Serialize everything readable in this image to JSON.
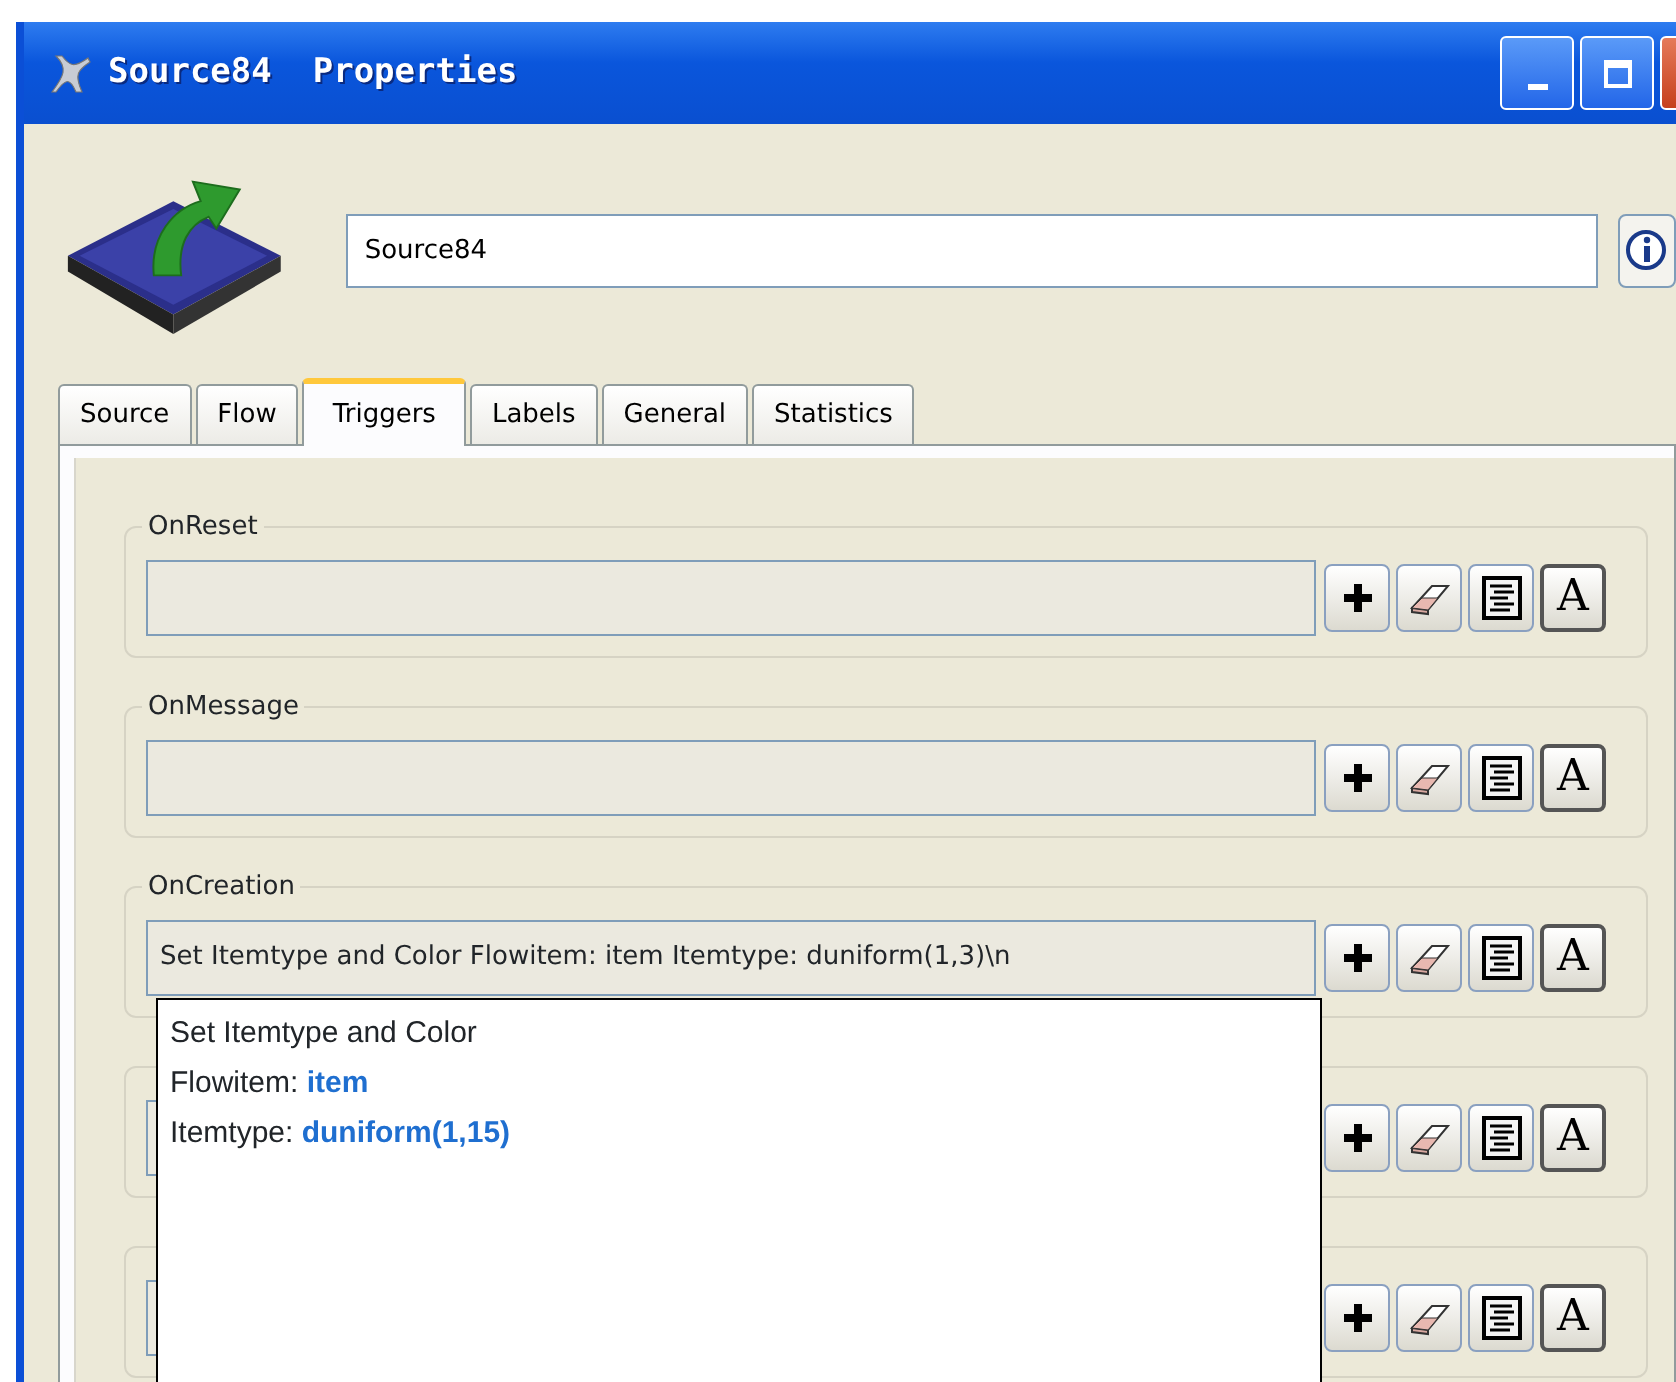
{
  "window": {
    "title": "Source84  Properties"
  },
  "name_field": {
    "value": "Source84"
  },
  "tabs": [
    {
      "label": "Source",
      "selected": false
    },
    {
      "label": "Flow",
      "selected": false
    },
    {
      "label": "Triggers",
      "selected": true
    },
    {
      "label": "Labels",
      "selected": false
    },
    {
      "label": "General",
      "selected": false
    },
    {
      "label": "Statistics",
      "selected": false
    }
  ],
  "triggers": [
    {
      "label": "OnReset",
      "template_key": "A"
    },
    {
      "label": "OnMessage",
      "template_key": "A"
    },
    {
      "label": "OnCreation",
      "value": "Set Itemtype and Color Flowitem: item Itemtype: duniform(1,3)\\n",
      "template_key": "A"
    },
    {
      "template_key": "A"
    },
    {
      "template_key": "A"
    }
  ],
  "tooltip": {
    "lines": [
      "Set Itemtype and Color",
      "Flowitem: **item**",
      "Itemtype: **duniform(1,15)**"
    ]
  }
}
